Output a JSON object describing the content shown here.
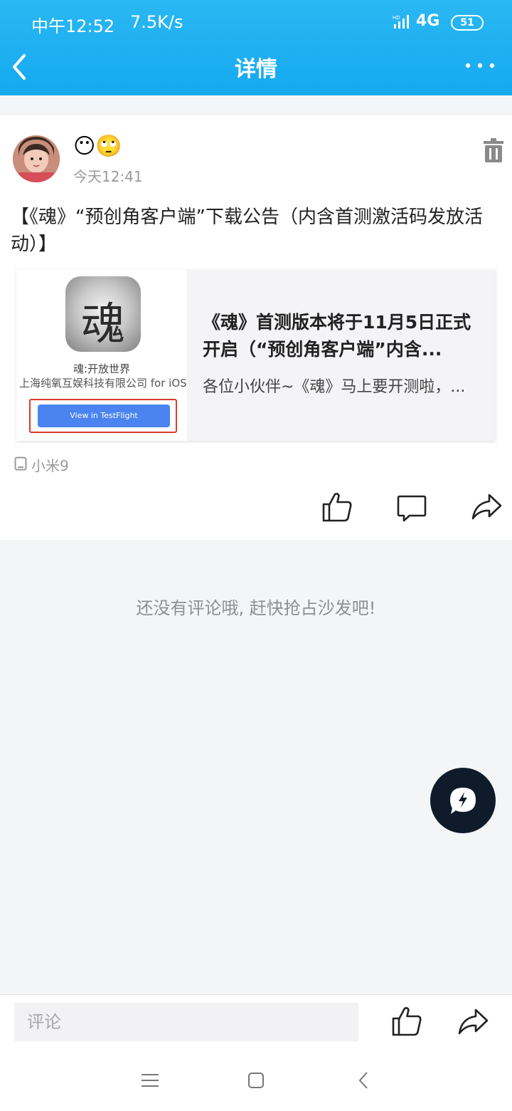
{
  "status_bar": {
    "time": "中午12:52",
    "net_speed": "7.5K/s",
    "network": "4G",
    "battery": "51",
    "hd_label": "HD"
  },
  "nav": {
    "title": "详情",
    "back_icon": "chevron-left-icon",
    "more_icon": "more-dots-icon"
  },
  "post": {
    "author_emoji": "😶🙄",
    "time": "今天12:41",
    "title": "【《魂》“预创角客户端”下载公告（内含首测激活码发放活动）】",
    "share_card": {
      "app_icon_char": "魂",
      "app_name": "魂:开放世界",
      "company": "上海纯氧互娱科技有限公司 for iOS",
      "testflight_button": "View in TestFlight",
      "title": "《魂》首测版本将于11月5日正式开启（“预创角客户端”内含...",
      "description": "各位小伙伴~《魂》马上要开测啦，..."
    },
    "device": "小米9"
  },
  "empty_comments": "还没有评论哦, 赶快抢占沙发吧!",
  "bottom_bar": {
    "comment_placeholder": "评论"
  },
  "colors": {
    "header": "#1aaef2",
    "fab": "#0f1b2a",
    "testflight_button": "#4a84f0",
    "highlight_outline": "#d63b2f"
  }
}
